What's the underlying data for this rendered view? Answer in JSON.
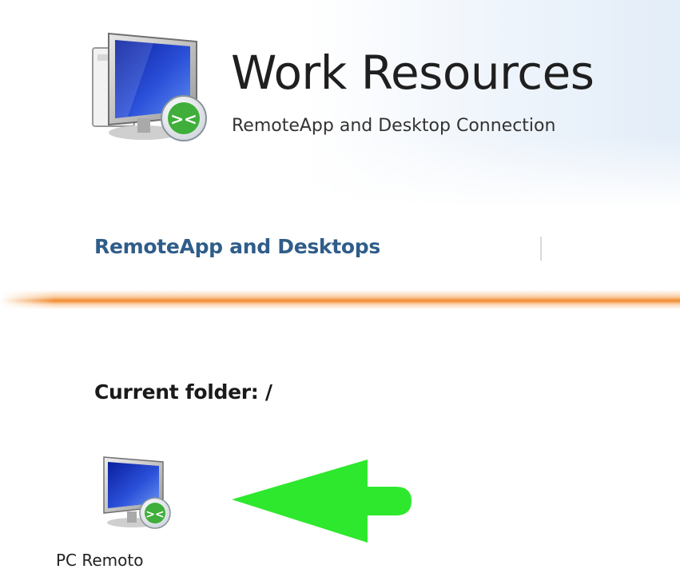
{
  "header": {
    "title": "Work Resources",
    "subtitle": "RemoteApp and Desktop Connection",
    "app_icon": "remote-desktop-computer-icon"
  },
  "nav": {
    "tabs": [
      {
        "label": "RemoteApp and Desktops"
      }
    ]
  },
  "content": {
    "current_folder_label": "Current folder: /",
    "items": [
      {
        "label": "PC Remoto",
        "icon": "remote-desktop-computer-icon"
      }
    ],
    "annotation": "green-arrow-icon"
  },
  "colors": {
    "nav_tab_text": "#2f5d8a",
    "accent_bar": "#f08a2c",
    "arrow": "#2ee82e"
  }
}
